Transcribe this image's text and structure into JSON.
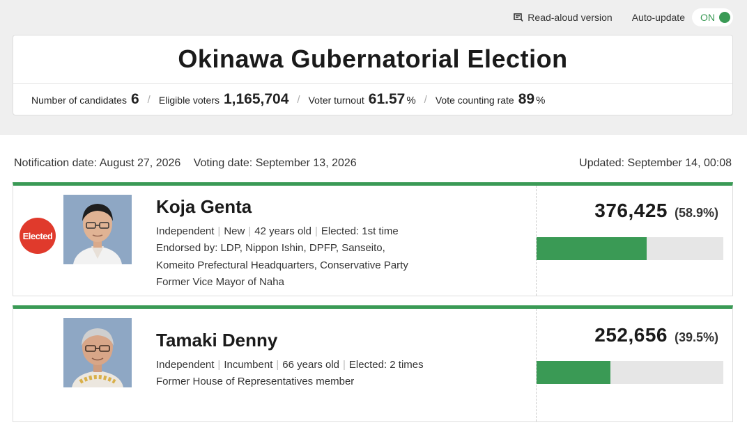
{
  "toolbar": {
    "read_aloud": "Read-aloud version",
    "auto_update_label": "Auto-update",
    "auto_update_state": "ON"
  },
  "election": {
    "title": "Okinawa Gubernatorial Election",
    "stats": {
      "candidates_label": "Number of candidates",
      "candidates_value": "6",
      "voters_label": "Eligible voters",
      "voters_value": "1,165,704",
      "turnout_label": "Voter turnout",
      "turnout_value": "61.57",
      "turnout_unit": "%",
      "counting_label": "Vote counting rate",
      "counting_value": "89",
      "counting_unit": "%"
    }
  },
  "dates": {
    "notification": "Notification date: August 27, 2026",
    "voting": "Voting date: September 13, 2026",
    "updated": "Updated: September 14, 00:08"
  },
  "candidates": [
    {
      "badge": "Elected",
      "name": "Koja Genta",
      "party": "Independent",
      "status": "New",
      "age": "42 years old",
      "elected": "Elected: 1st time",
      "endorsed_1": "Endorsed by: LDP, Nippon Ishin, DPFP, Sanseito,",
      "endorsed_2": "Komeito Prefectural Headquarters, Conservative Party",
      "career": "Former Vice Mayor of Naha",
      "votes": "376,425",
      "percent_text": "(58.9%)",
      "share": 0.589
    },
    {
      "name": "Tamaki Denny",
      "party": "Independent",
      "status": "Incumbent",
      "age": "66 years old",
      "elected": "Elected: 2 times",
      "career": "Former House of Representatives member",
      "votes": "252,656",
      "percent_text": "(39.5%)",
      "share": 0.395
    }
  ],
  "colors": {
    "accent": "#3a9a55",
    "elected_badge": "#e03a2c"
  }
}
